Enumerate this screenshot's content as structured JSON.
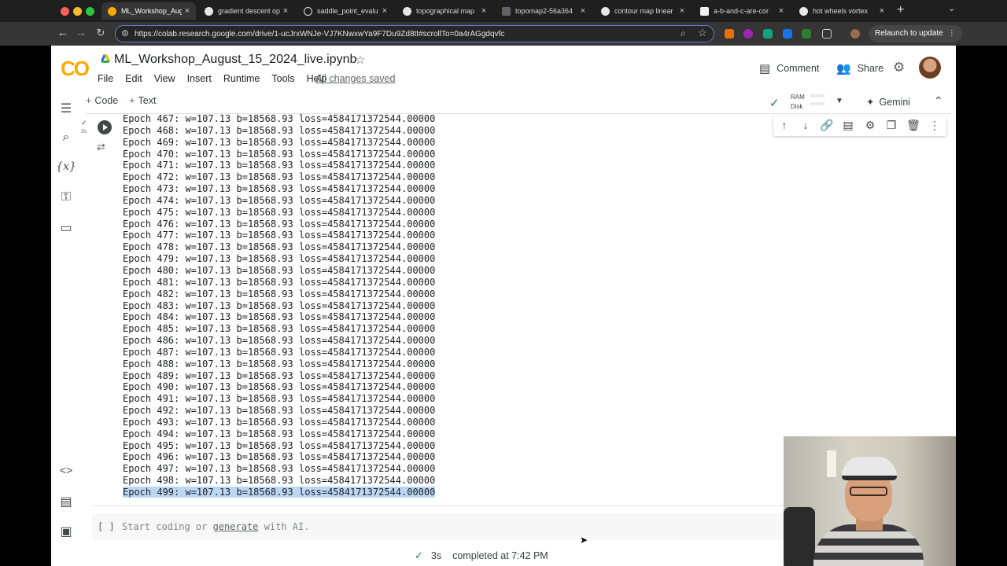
{
  "browser": {
    "tabs": [
      {
        "title": "ML_Workshop_Aug",
        "active": true
      },
      {
        "title": "gradient descent op"
      },
      {
        "title": "saddle_point_evalu"
      },
      {
        "title": "topographical map"
      },
      {
        "title": "topomap2-56a364"
      },
      {
        "title": "contour map linear"
      },
      {
        "title": "a-b-and-c-are-cor"
      },
      {
        "title": "hot wheels vortex"
      }
    ],
    "url": "https://colab.research.google.com/drive/1-ucJrxWNJe-VJ7KNwxwYa9F7Du9Zd8tt#scrollTo=0a4rAGgdqvfc",
    "relaunch_label": "Relaunch to update"
  },
  "notebook": {
    "logo_text": "CO",
    "title": "ML_Workshop_August_15_2024_live.ipynb",
    "menu": [
      "File",
      "Edit",
      "View",
      "Insert",
      "Runtime",
      "Tools",
      "Help"
    ],
    "saved_status": "All changes saved",
    "comment_label": "Comment",
    "share_label": "Share",
    "add_code_label": "Code",
    "add_text_label": "Text",
    "ram_label": "RAM",
    "disk_label": "Disk",
    "gemini_label": "Gemini",
    "exec_time": "3s"
  },
  "output_lines": [
    "Epoch 467: w=107.13 b=18568.93 loss=4584171372544.00000",
    "Epoch 468: w=107.13 b=18568.93 loss=4584171372544.00000",
    "Epoch 469: w=107.13 b=18568.93 loss=4584171372544.00000",
    "Epoch 470: w=107.13 b=18568.93 loss=4584171372544.00000",
    "Epoch 471: w=107.13 b=18568.93 loss=4584171372544.00000",
    "Epoch 472: w=107.13 b=18568.93 loss=4584171372544.00000",
    "Epoch 473: w=107.13 b=18568.93 loss=4584171372544.00000",
    "Epoch 474: w=107.13 b=18568.93 loss=4584171372544.00000",
    "Epoch 475: w=107.13 b=18568.93 loss=4584171372544.00000",
    "Epoch 476: w=107.13 b=18568.93 loss=4584171372544.00000",
    "Epoch 477: w=107.13 b=18568.93 loss=4584171372544.00000",
    "Epoch 478: w=107.13 b=18568.93 loss=4584171372544.00000",
    "Epoch 479: w=107.13 b=18568.93 loss=4584171372544.00000",
    "Epoch 480: w=107.13 b=18568.93 loss=4584171372544.00000",
    "Epoch 481: w=107.13 b=18568.93 loss=4584171372544.00000",
    "Epoch 482: w=107.13 b=18568.93 loss=4584171372544.00000",
    "Epoch 483: w=107.13 b=18568.93 loss=4584171372544.00000",
    "Epoch 484: w=107.13 b=18568.93 loss=4584171372544.00000",
    "Epoch 485: w=107.13 b=18568.93 loss=4584171372544.00000",
    "Epoch 486: w=107.13 b=18568.93 loss=4584171372544.00000",
    "Epoch 487: w=107.13 b=18568.93 loss=4584171372544.00000",
    "Epoch 488: w=107.13 b=18568.93 loss=4584171372544.00000",
    "Epoch 489: w=107.13 b=18568.93 loss=4584171372544.00000",
    "Epoch 490: w=107.13 b=18568.93 loss=4584171372544.00000",
    "Epoch 491: w=107.13 b=18568.93 loss=4584171372544.00000",
    "Epoch 492: w=107.13 b=18568.93 loss=4584171372544.00000",
    "Epoch 493: w=107.13 b=18568.93 loss=4584171372544.00000",
    "Epoch 494: w=107.13 b=18568.93 loss=4584171372544.00000",
    "Epoch 495: w=107.13 b=18568.93 loss=4584171372544.00000",
    "Epoch 496: w=107.13 b=18568.93 loss=4584171372544.00000",
    "Epoch 497: w=107.13 b=18568.93 loss=4584171372544.00000",
    "Epoch 498: w=107.13 b=18568.93 loss=4584171372544.00000",
    "Epoch 499: w=107.13 b=18568.93 loss=4584171372544.00000"
  ],
  "empty_cell": {
    "brackets": "[ ]",
    "hint_prefix": "Start coding or ",
    "hint_link": "generate",
    "hint_suffix": " with AI."
  },
  "status_bar": {
    "duration": "3s",
    "completed_text": "completed at 7:42 PM"
  },
  "colors": {
    "accent": "#f9ab00",
    "selection": "#bcd7f5",
    "success": "#188038"
  }
}
